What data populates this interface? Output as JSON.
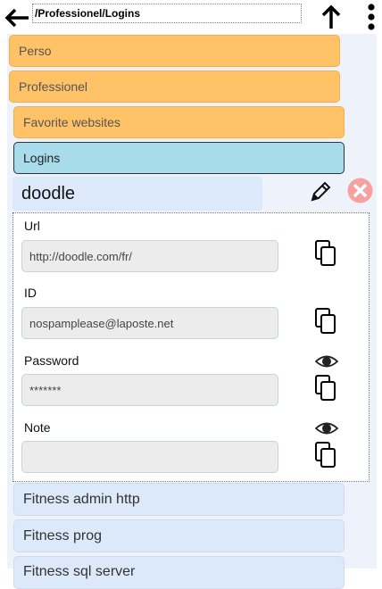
{
  "header": {
    "path": "/Professionel/Logins"
  },
  "tree": {
    "groups": [
      "Perso",
      "Professionel",
      "Favorite websites",
      "Logins"
    ]
  },
  "entry": {
    "title": "doodle",
    "fields": [
      {
        "label": "Url",
        "value": "http://doodle.com/fr/"
      },
      {
        "label": "ID",
        "value": "nospamplease@laposte.net"
      },
      {
        "label": "Password",
        "value": "*******"
      },
      {
        "label": "Note",
        "value": ""
      }
    ]
  },
  "list": [
    "Fitness admin http",
    "Fitness prog",
    "Fitness sql server"
  ],
  "colors": {
    "group": "#ffc266",
    "selected": "#a8dcea",
    "item": "#dce9fb",
    "delete": "#f7a0a0"
  },
  "icons": [
    "back-arrow-icon",
    "up-arrow-icon",
    "kebab-menu-icon",
    "pencil-icon",
    "delete-icon",
    "copy-icon",
    "eye-icon"
  ]
}
